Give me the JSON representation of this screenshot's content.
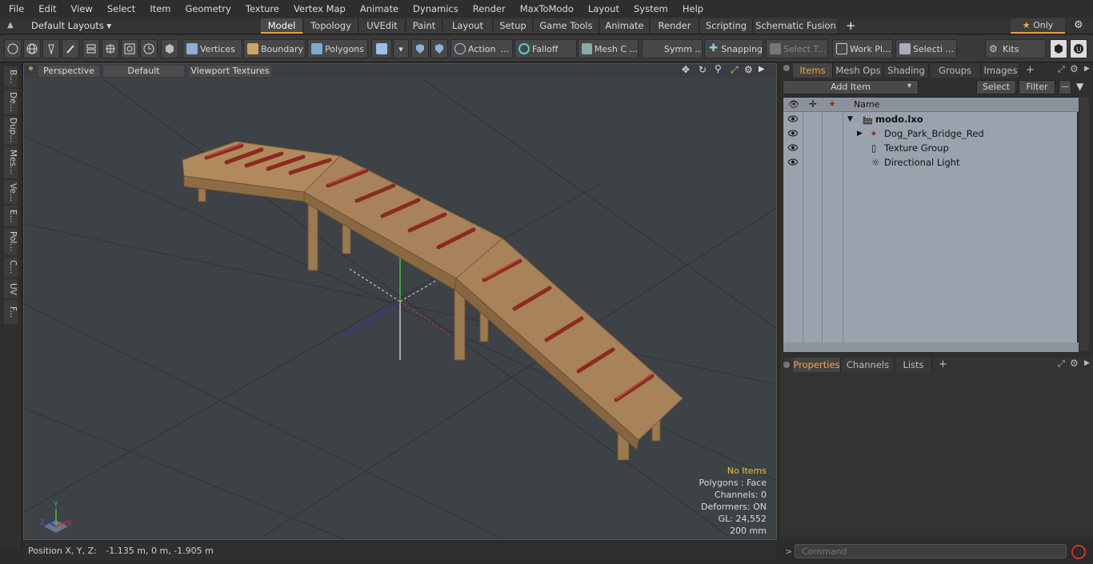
{
  "menubar": {
    "items": [
      "File",
      "Edit",
      "View",
      "Select",
      "Item",
      "Geometry",
      "Texture",
      "Vertex Map",
      "Animate",
      "Dynamics",
      "Render",
      "MaxToModo",
      "Layout",
      "System",
      "Help"
    ]
  },
  "tabbar": {
    "layout_dropdown": "Default Layouts",
    "tabs": [
      "Model",
      "Topology",
      "UVEdit",
      "Paint",
      "Layout",
      "Setup",
      "Game Tools",
      "Animate",
      "Render",
      "Scripting",
      "Schematic Fusion"
    ],
    "add": "+",
    "only_label": "Only"
  },
  "toolbar": {
    "vertices": "Vertices",
    "boundary": "Boundary",
    "polygons": "Polygons",
    "action": "Action",
    "falloff": "Falloff",
    "mesh": "Mesh C ...",
    "symm": "Symm ...",
    "snapping": "Snapping",
    "select_t": "Select T...",
    "workpl": "Work Pl...",
    "selecti": "Selecti ...",
    "kits": "Kits"
  },
  "leftstrip": {
    "tabs": [
      "B...",
      "De...",
      "Dup...",
      "Mes...",
      "Ve...",
      "E...",
      "Pol...",
      "C...",
      "UV",
      "F..."
    ]
  },
  "viewport": {
    "view": "Perspective",
    "style": "Default",
    "textures": "Viewport Textures",
    "info": {
      "no_items": "No Items",
      "polygons": "Polygons : Face",
      "channels": "Channels: 0",
      "deformers": "Deformers: ON",
      "gl": "GL: 24,552",
      "scale": "200 mm"
    },
    "axis_labels": {
      "y": "Y",
      "z": "Z",
      "x": "X"
    }
  },
  "statusbar": {
    "position_label": "Position X, Y, Z:",
    "position_value": "-1.135 m, 0 m, -1.905 m"
  },
  "items_panel": {
    "tabs": [
      "Items",
      "Mesh Ops",
      "Shading",
      "Groups",
      "Images",
      "+"
    ],
    "add_item": "Add Item",
    "select": "Select",
    "filter": "Filter",
    "column_name": "Name",
    "rows": [
      "modo.lxo",
      "Dog_Park_Bridge_Red",
      "Texture Group",
      "Directional Light"
    ]
  },
  "props_panel": {
    "tabs": [
      "Properties",
      "Channels",
      "Lists",
      "+"
    ]
  },
  "command": {
    "placeholder": "Command"
  },
  "colors": {
    "accent": "#e8a13a",
    "wood": "#b08a5c",
    "bone": "#a83a2c",
    "viewport": "#3d4246",
    "list_bg": "#9aa3ad"
  }
}
